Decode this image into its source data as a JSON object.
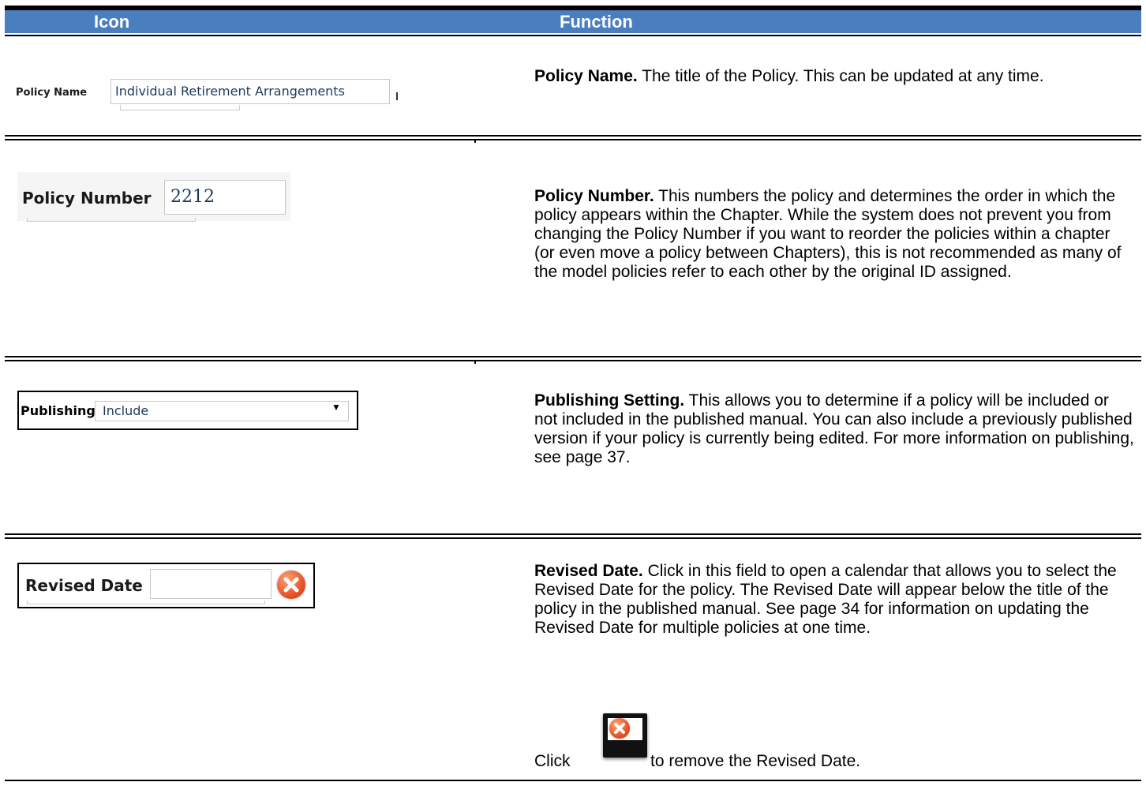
{
  "header": {
    "col1": "Icon",
    "col2": "Function"
  },
  "rows": [
    {
      "widget": {
        "label": "Policy Name",
        "value": "Individual Retirement Arrangements"
      },
      "title": "Policy Name.",
      "text": "  The title of the Policy.  This can be updated at any time."
    },
    {
      "widget": {
        "label": "Policy Number",
        "value": "2212"
      },
      "title": "Policy Number.",
      "text": "  This numbers the policy and determines the order in which the policy appears within the Chapter.  While the system does not prevent you from changing the Policy Number if you want to reorder the policies within a chapter (or even move a policy between Chapters), this is not recommended as many of the model policies refer to each other by the original ID assigned."
    },
    {
      "widget": {
        "label": "Publishing",
        "value": "Include"
      },
      "title": "Publishing Setting.",
      "text": "  This allows you to determine if a policy will be included or not included in the published manual.  You can also include a previously published version if your policy is currently being edited.   For more information on publishing, see page 37."
    },
    {
      "widget": {
        "label": "Revised Date",
        "value": ""
      },
      "title": "Revised Date.",
      "text": "  Click in this field to open a calendar that allows you to select the Revised Date for the policy.  The Revised Date will appear below the title of the policy in the published manual.  See page 34 for information on updating the Revised Date for multiple policies at one time.",
      "click_pre": "Click",
      "click_post": "to remove the Revised Date."
    }
  ],
  "icons": {
    "remove": "remove-x-icon",
    "dropdown": "dropdown-caret-icon"
  },
  "colors": {
    "header_bg": "#4a7fbf",
    "remove_icon": "#e24a1f"
  }
}
